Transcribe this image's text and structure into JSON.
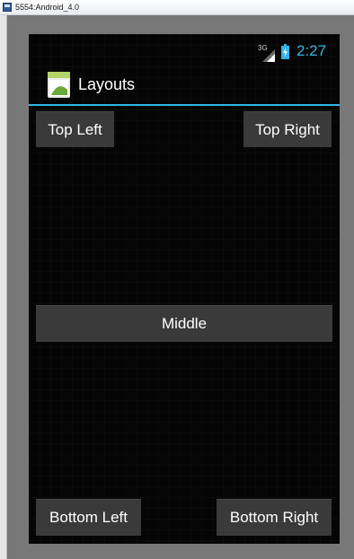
{
  "window": {
    "title": "5554:Android_4.0",
    "icon": "emulator-window-icon"
  },
  "status_bar": {
    "network_label": "3G",
    "signal_icon": "signal-icon",
    "battery_icon": "battery-icon",
    "time": "2:27"
  },
  "action_bar": {
    "icon": "app-launcher-icon",
    "title": "Layouts"
  },
  "buttons": {
    "top_left": "Top Left",
    "top_right": "Top Right",
    "middle": "Middle",
    "bottom_left": "Bottom Left",
    "bottom_right": "Bottom Right"
  },
  "colors": {
    "accent": "#33b5e5",
    "button_bg": "#3a3a3a",
    "screen_bg": "#050505",
    "frame": "#787878"
  }
}
